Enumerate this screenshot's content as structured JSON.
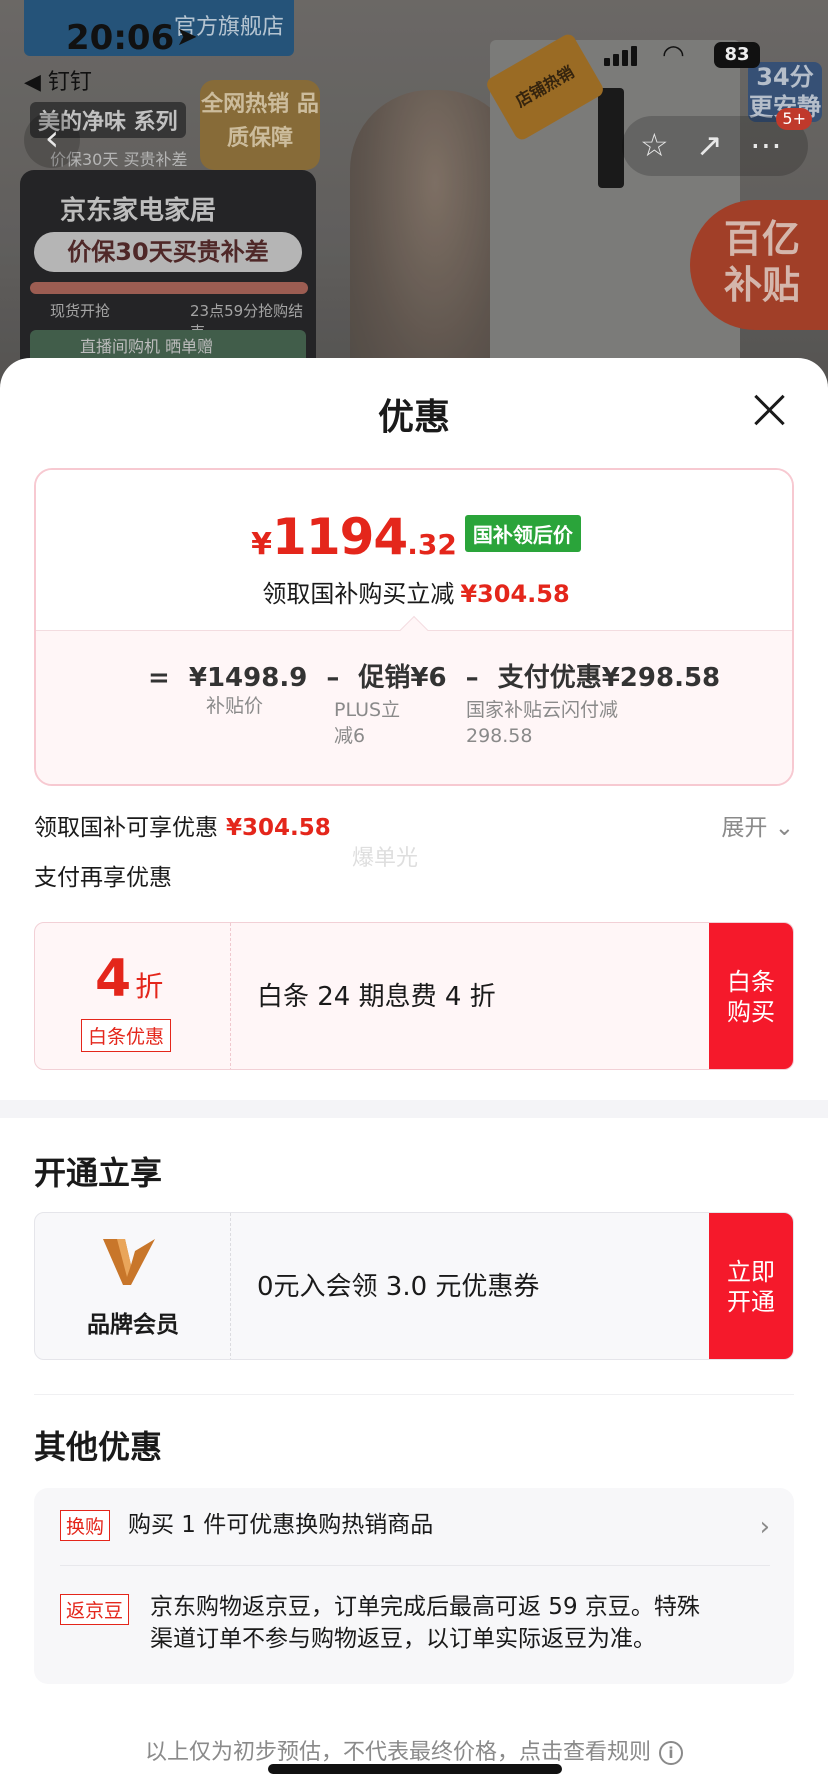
{
  "status_bar": {
    "time": "20:06",
    "battery": "83",
    "back_app": "◀ 钉钉"
  },
  "background": {
    "store_tag": "官方旗舰店",
    "series": "美的净味 系列",
    "series_sub": "价保30天 买贵补差",
    "badge": "全网热销 品质保障",
    "card_title": "京东家电家居",
    "card_banner": "价保30天买贵补差",
    "card_left": "现货开抢",
    "card_right": "23点59分抢购结束",
    "card_bottom": "直播间购机  晒单赠",
    "hot_tag": "店铺热销",
    "subsidy": "百亿 补贴",
    "timer": "34分 更安静",
    "msg_count": "5+"
  },
  "sheet": {
    "title": "优惠",
    "price": {
      "currency": "¥",
      "integer": "1194",
      "decimal": ".32",
      "tag": "国补领后价",
      "sub_label": "领取国补购买立减",
      "sub_value": "¥304.58"
    },
    "formula": {
      "eq": "=",
      "base": "¥1498.9",
      "minus1": "–",
      "promo": "促销¥6",
      "minus2": "–",
      "pay": "支付优惠¥298.58",
      "base_label": "补贴价",
      "promo_label_1": "PLUS立",
      "promo_label_2": "减6",
      "pay_label_1": "国家补贴云闪付减",
      "pay_label_2": "298.58"
    },
    "subsidy_line": {
      "label": "领取国补可享优惠",
      "value": "¥304.58",
      "expand": "展开"
    },
    "watermark": "爆单光",
    "pay_again": "支付再享优惠",
    "baitiao": {
      "discount": "4",
      "unit": "折",
      "tag": "白条优惠",
      "desc": "白条 24 期息费 4 折",
      "action_1": "白条",
      "action_2": "购买"
    },
    "open_section": {
      "title": "开通立享"
    },
    "member": {
      "brand": "品牌会员",
      "desc": "0元入会领 3.0 元优惠券",
      "action_1": "立即",
      "action_2": "开通"
    },
    "other_section": {
      "title": "其他优惠"
    },
    "other": [
      {
        "tag": "换购",
        "text": "购买 1 件可优惠换购热销商品"
      },
      {
        "tag": "返京豆",
        "text_1": "京东购物返京豆，订单完成后最高可返 59 京豆。特殊",
        "text_2": "渠道订单不参与购物返豆，以订单实际返豆为准。"
      }
    ],
    "footer": "以上仅为初步预估，不代表最终价格，点击查看规则",
    "info_icon": "i"
  },
  "colors": {
    "accent_red": "#e4261b",
    "button_red": "#f5192b",
    "green_tag": "#2aa43a"
  }
}
